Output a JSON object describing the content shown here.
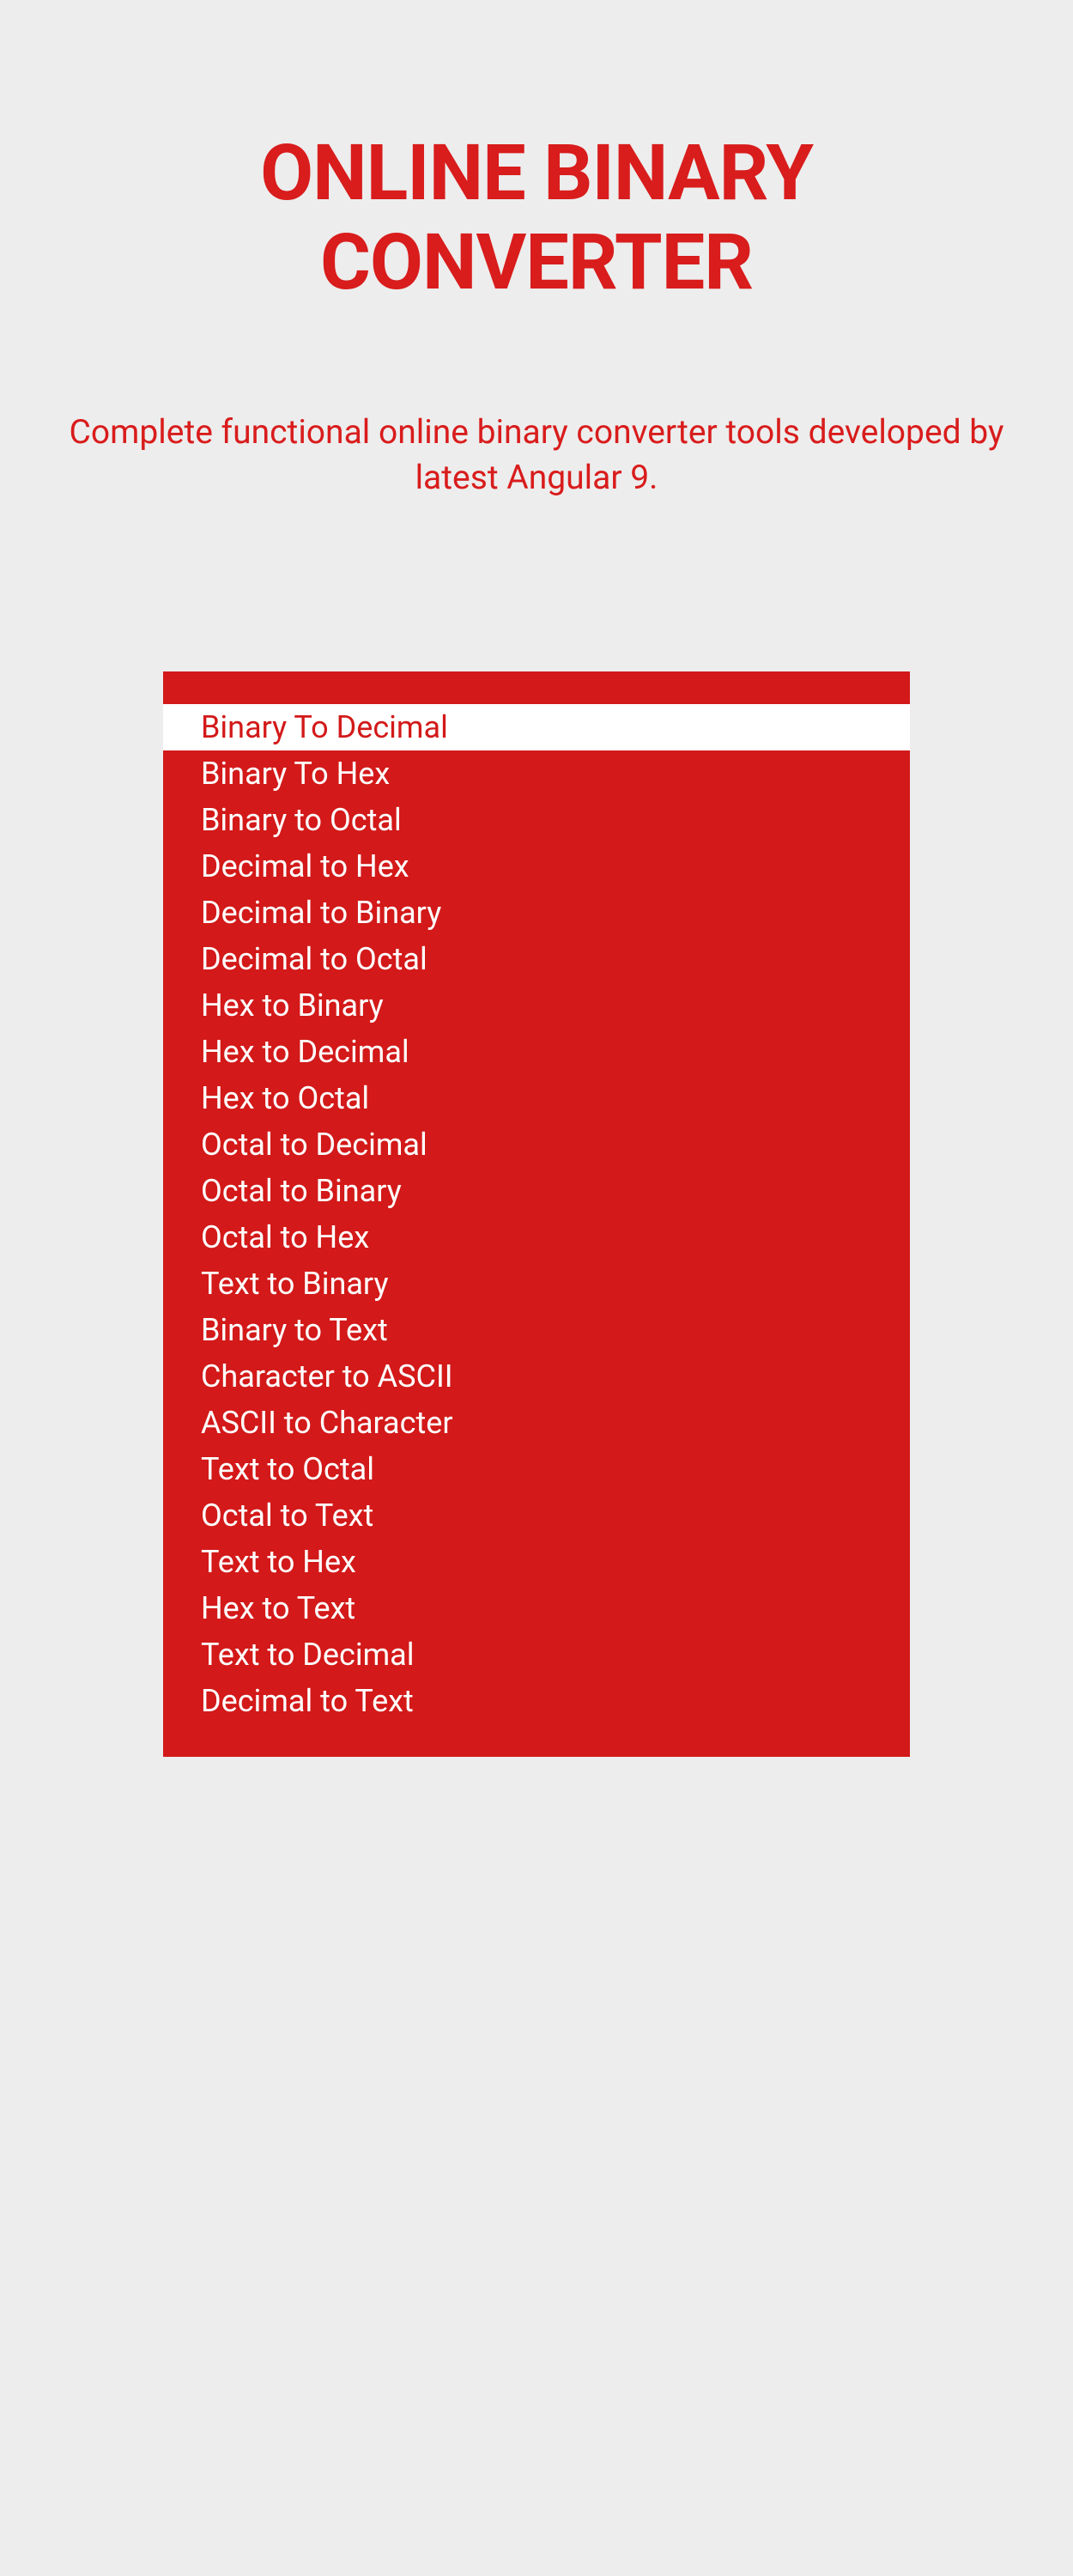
{
  "header": {
    "title_line1": "ONLINE BINARY",
    "title_line2": "CONVERTER",
    "subtitle": "Complete functional online binary converter tools developed by latest Angular 9."
  },
  "menu": {
    "selected_index": 0,
    "items": [
      "Binary To Decimal",
      "Binary To Hex",
      "Binary to Octal",
      "Decimal to Hex",
      "Decimal to Binary",
      "Decimal to Octal",
      "Hex to Binary",
      "Hex to Decimal",
      "Hex to Octal",
      "Octal to Decimal",
      "Octal to Binary",
      "Octal to Hex",
      "Text to Binary",
      "Binary to Text",
      "Character to ASCII",
      "ASCII to Character",
      "Text to Octal",
      "Octal to Text",
      "Text to Hex",
      "Hex to Text",
      "Text to Decimal",
      "Decimal to Text"
    ]
  },
  "colors": {
    "accent": "#D91C1C",
    "menu_bg": "#D31919",
    "page_bg": "#EDEDED"
  }
}
